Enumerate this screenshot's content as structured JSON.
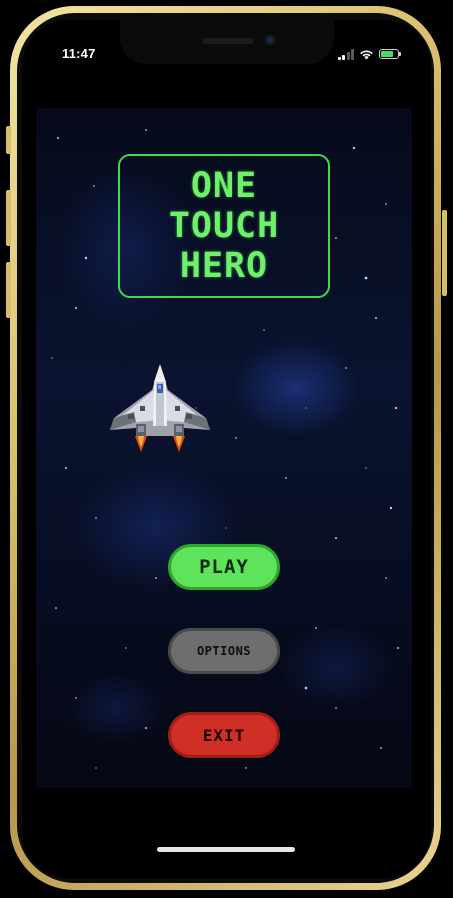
{
  "status_bar": {
    "time": "11:47",
    "signal_bars": 4,
    "signal_active_bars": 2,
    "battery_color": "#4cd964"
  },
  "game": {
    "title_lines": [
      "ONE",
      "TOUCH",
      "HERO"
    ],
    "title_color": "#6ff06a",
    "ship_icon": "spaceship-icon",
    "menu": {
      "play_label": "PLAY",
      "options_label": "OPTIONS",
      "exit_label": "EXIT"
    }
  },
  "colors": {
    "play": "#5fe35c",
    "options": "#6e6e6e",
    "exit": "#cf2f24",
    "frame": "#d9bf6c"
  }
}
